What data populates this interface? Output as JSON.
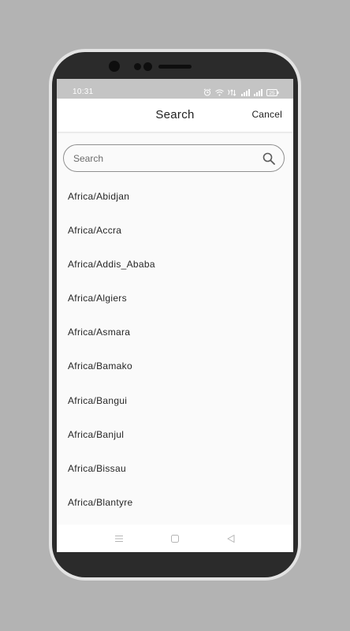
{
  "status_bar": {
    "time": "10:31",
    "battery_level": "25",
    "icons": [
      "alarm-icon",
      "wifi-icon",
      "data-transfer-icon",
      "signal-icon",
      "signal-icon",
      "battery-icon"
    ]
  },
  "header": {
    "title": "Search",
    "cancel_label": "Cancel"
  },
  "search": {
    "placeholder": "Search",
    "value": "",
    "icon": "search-icon"
  },
  "timezones": [
    "Africa/Abidjan",
    "Africa/Accra",
    "Africa/Addis_Ababa",
    "Africa/Algiers",
    "Africa/Asmara",
    "Africa/Bamako",
    "Africa/Bangui",
    "Africa/Banjul",
    "Africa/Bissau",
    "Africa/Blantyre"
  ],
  "nav_bar": {
    "buttons": [
      "menu-icon",
      "home-icon",
      "back-icon"
    ]
  },
  "colors": {
    "backdrop": "#b3b3b3",
    "device_frame": "#2b2b2b",
    "screen_background": "#fafafa",
    "status_bar": "#c4c4c4",
    "text_primary": "#1f1f1f",
    "search_border": "#8f8f8f"
  }
}
